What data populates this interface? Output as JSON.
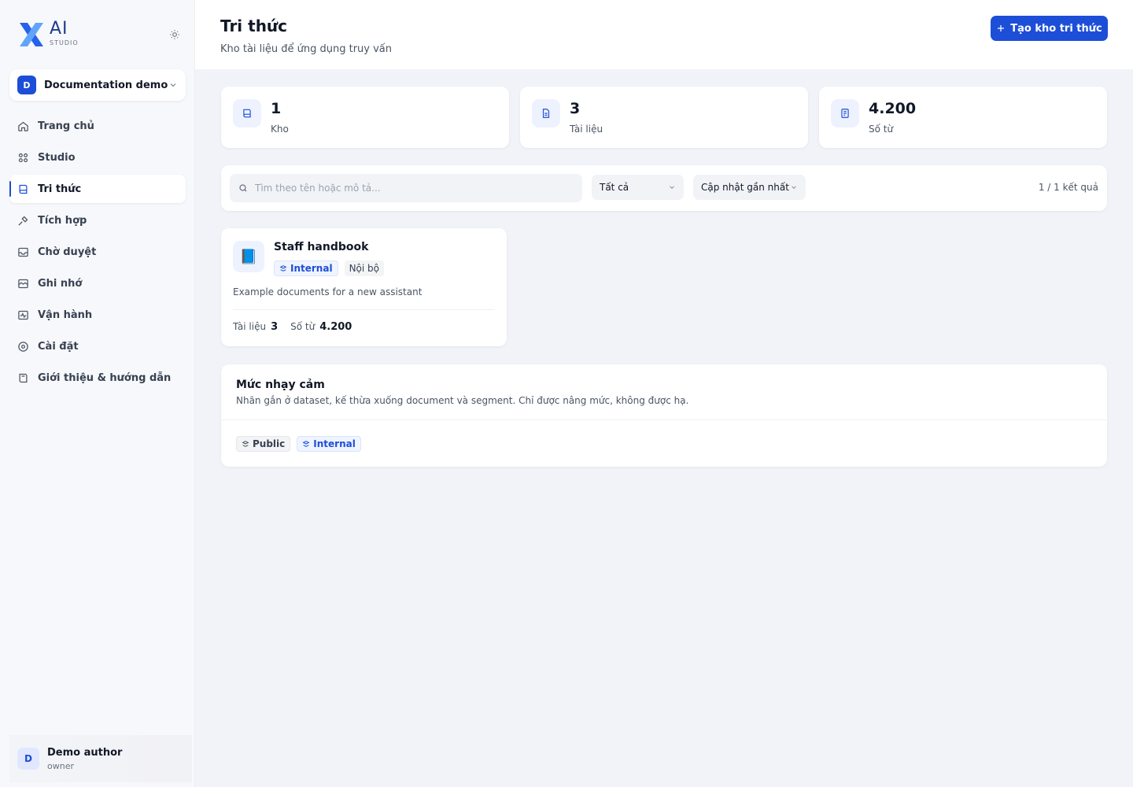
{
  "brand": {
    "mark": "X",
    "name": "AI",
    "subtitle": "STUDIO"
  },
  "workspace": {
    "initial": "D",
    "name": "Documentation demo"
  },
  "nav": [
    {
      "label": "Trang chủ",
      "icon": "home-icon"
    },
    {
      "label": "Studio",
      "icon": "grid-icon"
    },
    {
      "label": "Tri thức",
      "icon": "book-icon",
      "active": true
    },
    {
      "label": "Tích hợp",
      "icon": "integration-icon"
    },
    {
      "label": "Chờ duyệt",
      "icon": "inbox-icon"
    },
    {
      "label": "Ghi nhớ",
      "icon": "memory-icon"
    },
    {
      "label": "Vận hành",
      "icon": "activity-icon"
    },
    {
      "label": "Cài đặt",
      "icon": "settings-icon"
    },
    {
      "label": "Giới thiệu & hướng dẫn",
      "icon": "guide-icon"
    }
  ],
  "user": {
    "initial": "D",
    "name": "Demo author",
    "role": "owner"
  },
  "header": {
    "title": "Tri thức",
    "subtitle": "Kho tài liệu để ứng dụng truy vấn",
    "create_label": "Tạo kho tri thức"
  },
  "stats": [
    {
      "value": "1",
      "label": "Kho",
      "icon": "book-icon"
    },
    {
      "value": "3",
      "label": "Tài liệu",
      "icon": "document-icon"
    },
    {
      "value": "4.200",
      "label": "Số từ",
      "icon": "words-icon"
    }
  ],
  "filters": {
    "search_placeholder": "Tìm theo tên hoặc mô tả...",
    "type_value": "Tất cả",
    "sort_value": "Cập nhật gần nhất",
    "result_count": "1 / 1 kết quả"
  },
  "dataset": {
    "icon": "📘",
    "name": "Staff handbook",
    "sensitivity": "Internal",
    "scope": "Nội bộ",
    "description": "Example documents for a new assistant",
    "docs_label": "Tài liệu",
    "docs_value": "3",
    "words_label": "Số từ",
    "words_value": "4.200"
  },
  "sensitivity": {
    "title": "Mức nhạy cảm",
    "description": "Nhãn gắn ở dataset, kế thừa xuống document và segment. Chỉ được nâng mức, không được hạ.",
    "levels": [
      "Public",
      "Internal"
    ]
  },
  "colors": {
    "accent": "#1d4ed8",
    "background": "#f1f3f8",
    "card": "#ffffff"
  }
}
